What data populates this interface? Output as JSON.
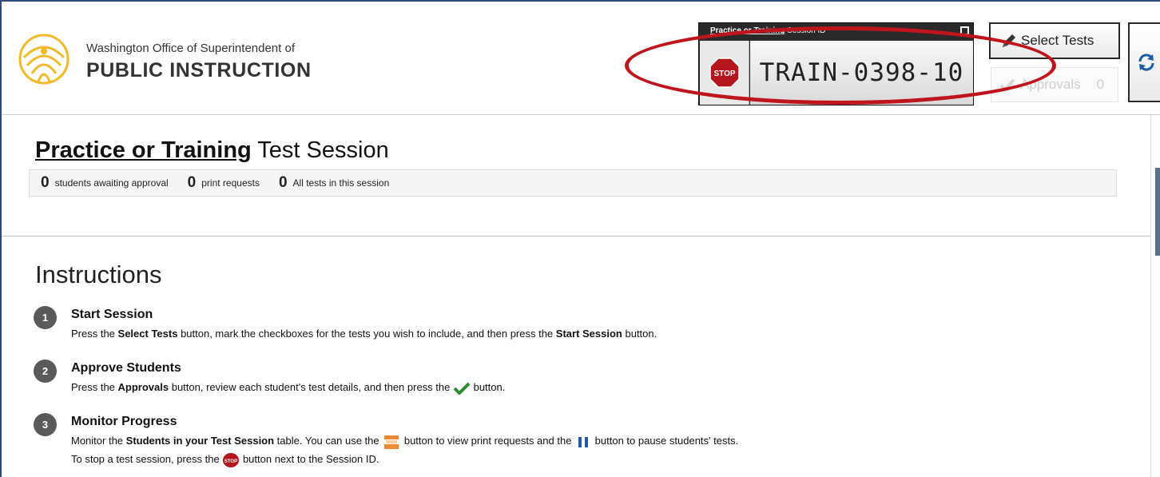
{
  "header": {
    "org_line1": "Washington Office of Superintendent of",
    "org_line2": "PUBLIC INSTRUCTION"
  },
  "session": {
    "mode_link": "Practice or Training",
    "id_label": "Session ID",
    "id_value": "TRAIN-0398-10",
    "stop_label": "STOP"
  },
  "toolbar": {
    "select_tests": "Select Tests",
    "approvals": "Approvals",
    "approvals_count": "0"
  },
  "page": {
    "title_mode": "Practice or Training",
    "title_rest": " Test Session"
  },
  "stats": [
    {
      "num": "0",
      "label": "students awaiting approval"
    },
    {
      "num": "0",
      "label": "print requests"
    },
    {
      "num": "0",
      "label": "All tests in this session"
    }
  ],
  "instructions": {
    "heading": "Instructions",
    "steps": [
      {
        "num": "1",
        "title": "Start Session",
        "t1": "Press the ",
        "b1": "Select Tests",
        "t2": " button, mark the checkboxes for the tests you wish to include, and then press the ",
        "b2": "Start Session",
        "t3": " button."
      },
      {
        "num": "2",
        "title": "Approve Students",
        "t1": "Press the ",
        "b1": "Approvals",
        "t2": " button, review each student's test details, and then press the ",
        "t3": " button."
      },
      {
        "num": "3",
        "title": "Monitor Progress",
        "t1": "Monitor the ",
        "b1": "Students in your Test Session",
        "t2": " table. You can use the ",
        "t3": " button to view print requests and the ",
        "t4": " button to pause students' tests.",
        "line2_a": "To stop a test session, press the ",
        "line2_b": " button next to the Session ID."
      }
    ]
  },
  "colors": {
    "highlight_ellipse": "#c0141c",
    "stop_red": "#b3161c",
    "check_green": "#2e8b2e",
    "print_orange": "#f08a32"
  }
}
